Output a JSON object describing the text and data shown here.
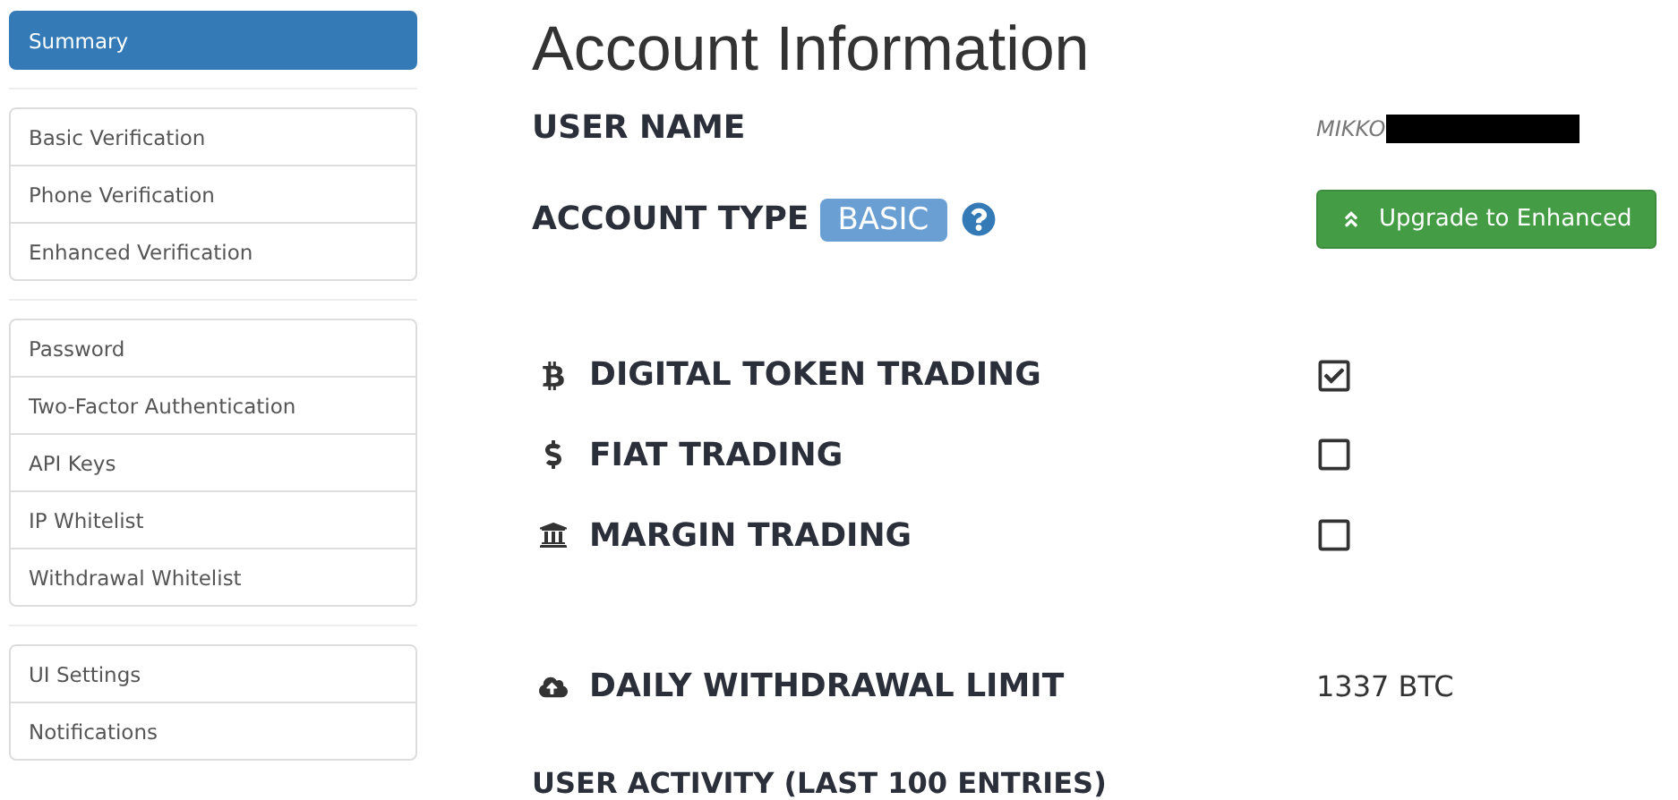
{
  "sidebar": {
    "groups": [
      {
        "items": [
          {
            "label": "Summary",
            "selected": true
          }
        ]
      },
      {
        "items": [
          {
            "label": "Basic Verification",
            "selected": false
          },
          {
            "label": "Phone Verification",
            "selected": false
          },
          {
            "label": "Enhanced Verification",
            "selected": false
          }
        ]
      },
      {
        "items": [
          {
            "label": "Password",
            "selected": false
          },
          {
            "label": "Two-Factor Authentication",
            "selected": false
          },
          {
            "label": "API Keys",
            "selected": false
          },
          {
            "label": "IP Whitelist",
            "selected": false
          },
          {
            "label": "Withdrawal Whitelist",
            "selected": false
          }
        ]
      },
      {
        "items": [
          {
            "label": "UI Settings",
            "selected": false
          },
          {
            "label": "Notifications",
            "selected": false
          }
        ]
      }
    ]
  },
  "title": "Account Information",
  "user_name": {
    "label": "USER NAME",
    "value": "MIKKO",
    "redacted": true
  },
  "account_type": {
    "label": "ACCOUNT TYPE",
    "badge": "BASIC",
    "upgrade_button": "Upgrade to Enhanced"
  },
  "permissions": [
    {
      "kind": "token",
      "label": "DIGITAL TOKEN TRADING",
      "checked": true
    },
    {
      "kind": "fiat",
      "label": "FIAT TRADING",
      "checked": false
    },
    {
      "kind": "margin",
      "label": "MARGIN TRADING",
      "checked": false
    }
  ],
  "withdrawal_limit": {
    "label": "DAILY WITHDRAWAL LIMIT",
    "value": "1337 BTC"
  },
  "activity_heading": "USER ACTIVITY (LAST 100 ENTRIES)"
}
